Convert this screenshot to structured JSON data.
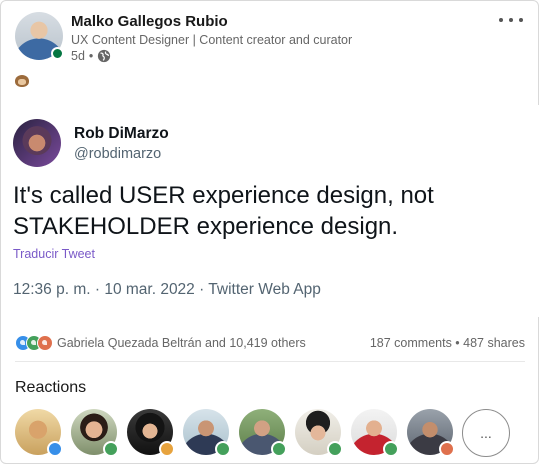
{
  "post": {
    "author_name": "Malko Gallegos Rubio",
    "author_headline": "UX Content Designer | Content creator and curator",
    "age": "5d",
    "separator": "•",
    "visibility_icon": "globe-icon",
    "emoji": "see-no-evil-monkey"
  },
  "tweet": {
    "name": "Rob DiMarzo",
    "handle": "@robdimarzo",
    "text": "It's called USER experience design, not STAKEHOLDER experience design.",
    "translate_link": "Traducir Tweet",
    "timestamp": "12:36 p. m. · 10 mar. 2022 · Twitter Web App"
  },
  "social": {
    "reactors": "Gabriela Quezada Beltrán and 10,419 others",
    "comments_shares": "187 comments • 487 shares"
  },
  "reactions": {
    "title": "Reactions",
    "more_label": "...",
    "people": [
      {
        "badge": "like-icon"
      },
      {
        "badge": "celebrate-icon"
      },
      {
        "badge": "insightful-icon"
      },
      {
        "badge": "celebrate-icon"
      },
      {
        "badge": "celebrate-icon"
      },
      {
        "badge": "celebrate-icon"
      },
      {
        "badge": "celebrate-icon"
      },
      {
        "badge": "love-icon"
      }
    ]
  },
  "colors": {
    "presence": "#057642",
    "like": "#378fe9",
    "celebrate": "#44a05b",
    "love": "#df704d",
    "insightful": "#e7a33e",
    "translate_link": "#7a5ac8"
  }
}
